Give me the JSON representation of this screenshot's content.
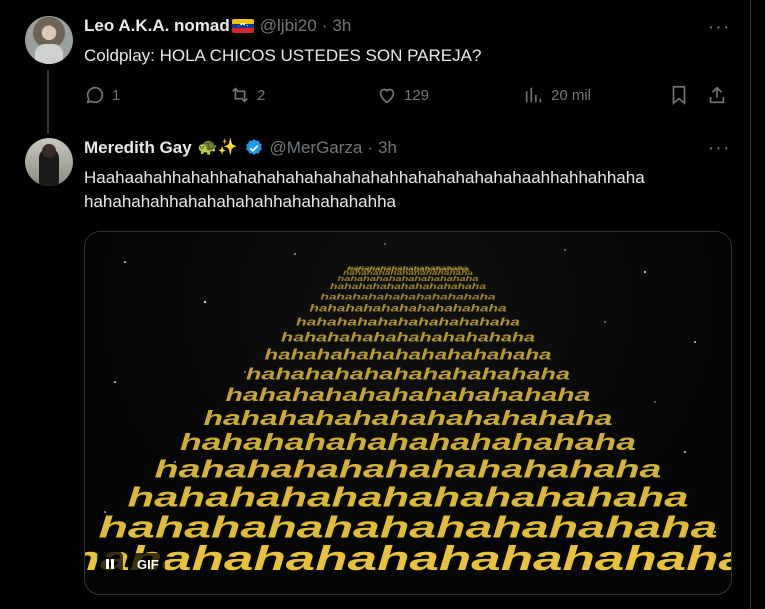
{
  "post1": {
    "name": "Leo A.K.A. nomad",
    "handle": "@ljbi20",
    "separator": "·",
    "time": "3h",
    "text": "Coldplay: HOLA CHICOS USTEDES SON PAREJA?",
    "actions": {
      "replies": "1",
      "reposts": "2",
      "likes": "129",
      "views": "20 mil"
    }
  },
  "post2": {
    "name": "Meredith Gay",
    "emoji": "🐢✨",
    "handle": "@MerGarza",
    "separator": "·",
    "time": "3h",
    "text": "Haahaahahhahahhahahahahahahahahahhahahahahahahaahhahhahhaha\nhahahahahhahahahahahhahahahahahha",
    "media": {
      "gif_label": "GIF",
      "crawl_lines": [
        "hahahahahahahahahahaha",
        "hahahahahahahahahahaha",
        "hahahahahahahahahahaha",
        "hahahahahahahahahahaha",
        "hahahahahahahahahahaha",
        "hahahahahahahahahahaha",
        "hahahahahahahahahahaha",
        "hahahahahahahahahahaha",
        "hahahahahahahahahahaha",
        "hahahahahahahahahahaha",
        "hahahahahahahahahahaha",
        "hahahahahahahahahahaha",
        "hahahahahahahahahahaha",
        "hahahahahahahahahahaha",
        "hahahahahahahahahahaha",
        "hahahahahahahahahahaha",
        "hahahahahahahahahahaha",
        "hahahahahahahahahahaha"
      ]
    }
  },
  "colors": {
    "background": "#000000",
    "text": "#e7e9ea",
    "muted": "#71767b",
    "verified": "#1d9bf0",
    "crawl": "#e8c23a"
  }
}
